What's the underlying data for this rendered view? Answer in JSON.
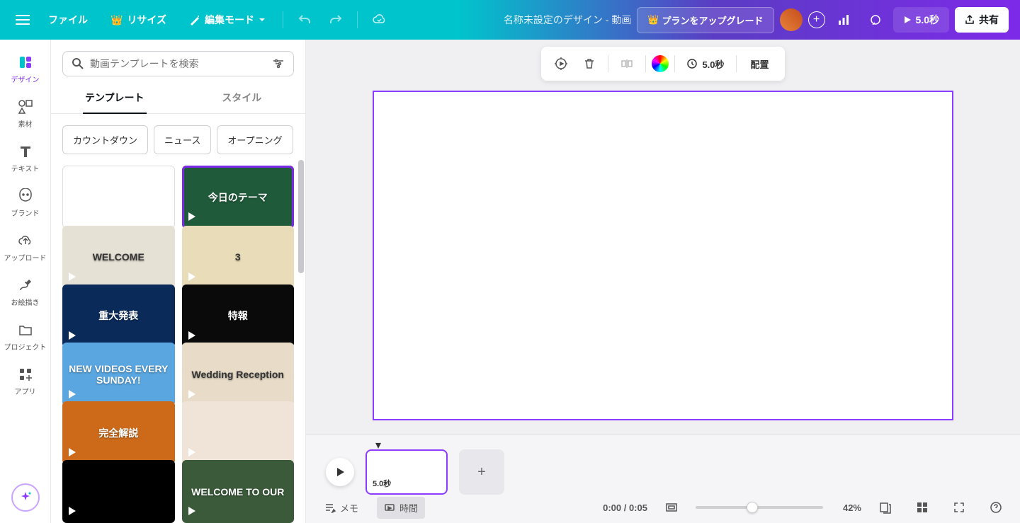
{
  "topbar": {
    "file": "ファイル",
    "resize": "リサイズ",
    "edit_mode": "編集モード",
    "doc_title": "名称未設定のデザイン - 動画",
    "upgrade": "プランをアップグレード",
    "play_duration": "5.0秒",
    "share": "共有"
  },
  "rail": {
    "design": "デザイン",
    "elements": "素材",
    "text": "テキスト",
    "brand": "ブランド",
    "upload": "アップロード",
    "draw": "お絵描き",
    "projects": "プロジェクト",
    "apps": "アプリ"
  },
  "panel": {
    "search_placeholder": "動画テンプレートを検索",
    "tab_templates": "テンプレート",
    "tab_styles": "スタイル",
    "chips": [
      "カウントダウン",
      "ニュース",
      "オープニング"
    ],
    "templates": [
      {
        "bg": "#ffffff",
        "label": ""
      },
      {
        "bg": "#1f5a3a",
        "label": "今日のテーマ",
        "selected": true
      },
      {
        "bg": "#e6e1d5",
        "label": "WELCOME"
      },
      {
        "bg": "#e8ddb8",
        "label": "3"
      },
      {
        "bg": "#0a2a5a",
        "label": "重大発表"
      },
      {
        "bg": "#0a0a0a",
        "label": "特報"
      },
      {
        "bg": "#5aa6e0",
        "label": "NEW VIDEOS EVERY SUNDAY!"
      },
      {
        "bg": "#e8dcc8",
        "label": "Wedding Reception"
      },
      {
        "bg": "#cc6a1a",
        "label": "完全解説"
      },
      {
        "bg": "#f0e4d8",
        "label": ""
      },
      {
        "bg": "#000000",
        "label": ""
      },
      {
        "bg": "#3a5a3a",
        "label": "WELCOME TO OUR"
      }
    ]
  },
  "canvas_toolbar": {
    "duration": "5.0秒",
    "arrange": "配置"
  },
  "timeline": {
    "clip_duration": "5.0秒",
    "memo": "メモ",
    "time": "時間",
    "time_display": "0:00 / 0:05",
    "zoom": "42%"
  }
}
